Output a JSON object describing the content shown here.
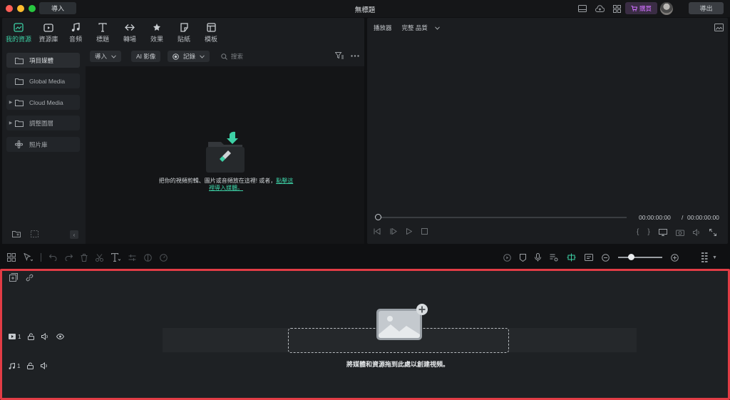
{
  "titlebar": {
    "import_label": "導入",
    "app_title": "無標題",
    "buy_label": "購買",
    "export_label": "導出",
    "icons": [
      "layout-icon",
      "cloud-icon",
      "grid-icon"
    ]
  },
  "media_tabs": [
    {
      "label": "我的資源",
      "icon": "folder-media-icon",
      "active": true
    },
    {
      "label": "資源庫",
      "icon": "stock-icon"
    },
    {
      "label": "音頻",
      "icon": "music-icon"
    },
    {
      "label": "標題",
      "icon": "title-icon"
    },
    {
      "label": "轉場",
      "icon": "transition-icon"
    },
    {
      "label": "效果",
      "icon": "effects-icon"
    },
    {
      "label": "貼紙",
      "icon": "sticker-icon"
    },
    {
      "label": "模板",
      "icon": "template-icon"
    }
  ],
  "sidebar": {
    "items": [
      {
        "label": "項目媒體",
        "selected": true
      },
      {
        "label": "Global Media"
      },
      {
        "label": "Cloud Media",
        "expandable": true
      },
      {
        "label": "調整圖層",
        "expandable": true
      },
      {
        "label": "照片庫"
      }
    ]
  },
  "media_toolbar": {
    "import_label": "導入",
    "ai_label": "AI 影像",
    "record_label": "記錄",
    "search_placeholder": "搜索"
  },
  "media_drop": {
    "text": "把你的視頻剪輯、圖片或音頻放在這裡! 或者，",
    "link_text": "點擊這裡導入媒體。"
  },
  "player": {
    "label": "播放器",
    "quality": "完整 品質",
    "current_time": "00:00:00:00",
    "separator": "/",
    "total_time": "00:00:00:00",
    "progress": 0
  },
  "timeline": {
    "video_track_num": "1",
    "audio_track_num": "1",
    "drop_hint": "將媒體和資源拖到此處以創建視頻。",
    "highlight_color": "#e23c45"
  },
  "colors": {
    "accent": "#3dd0a5",
    "buy": "#d070ff"
  }
}
